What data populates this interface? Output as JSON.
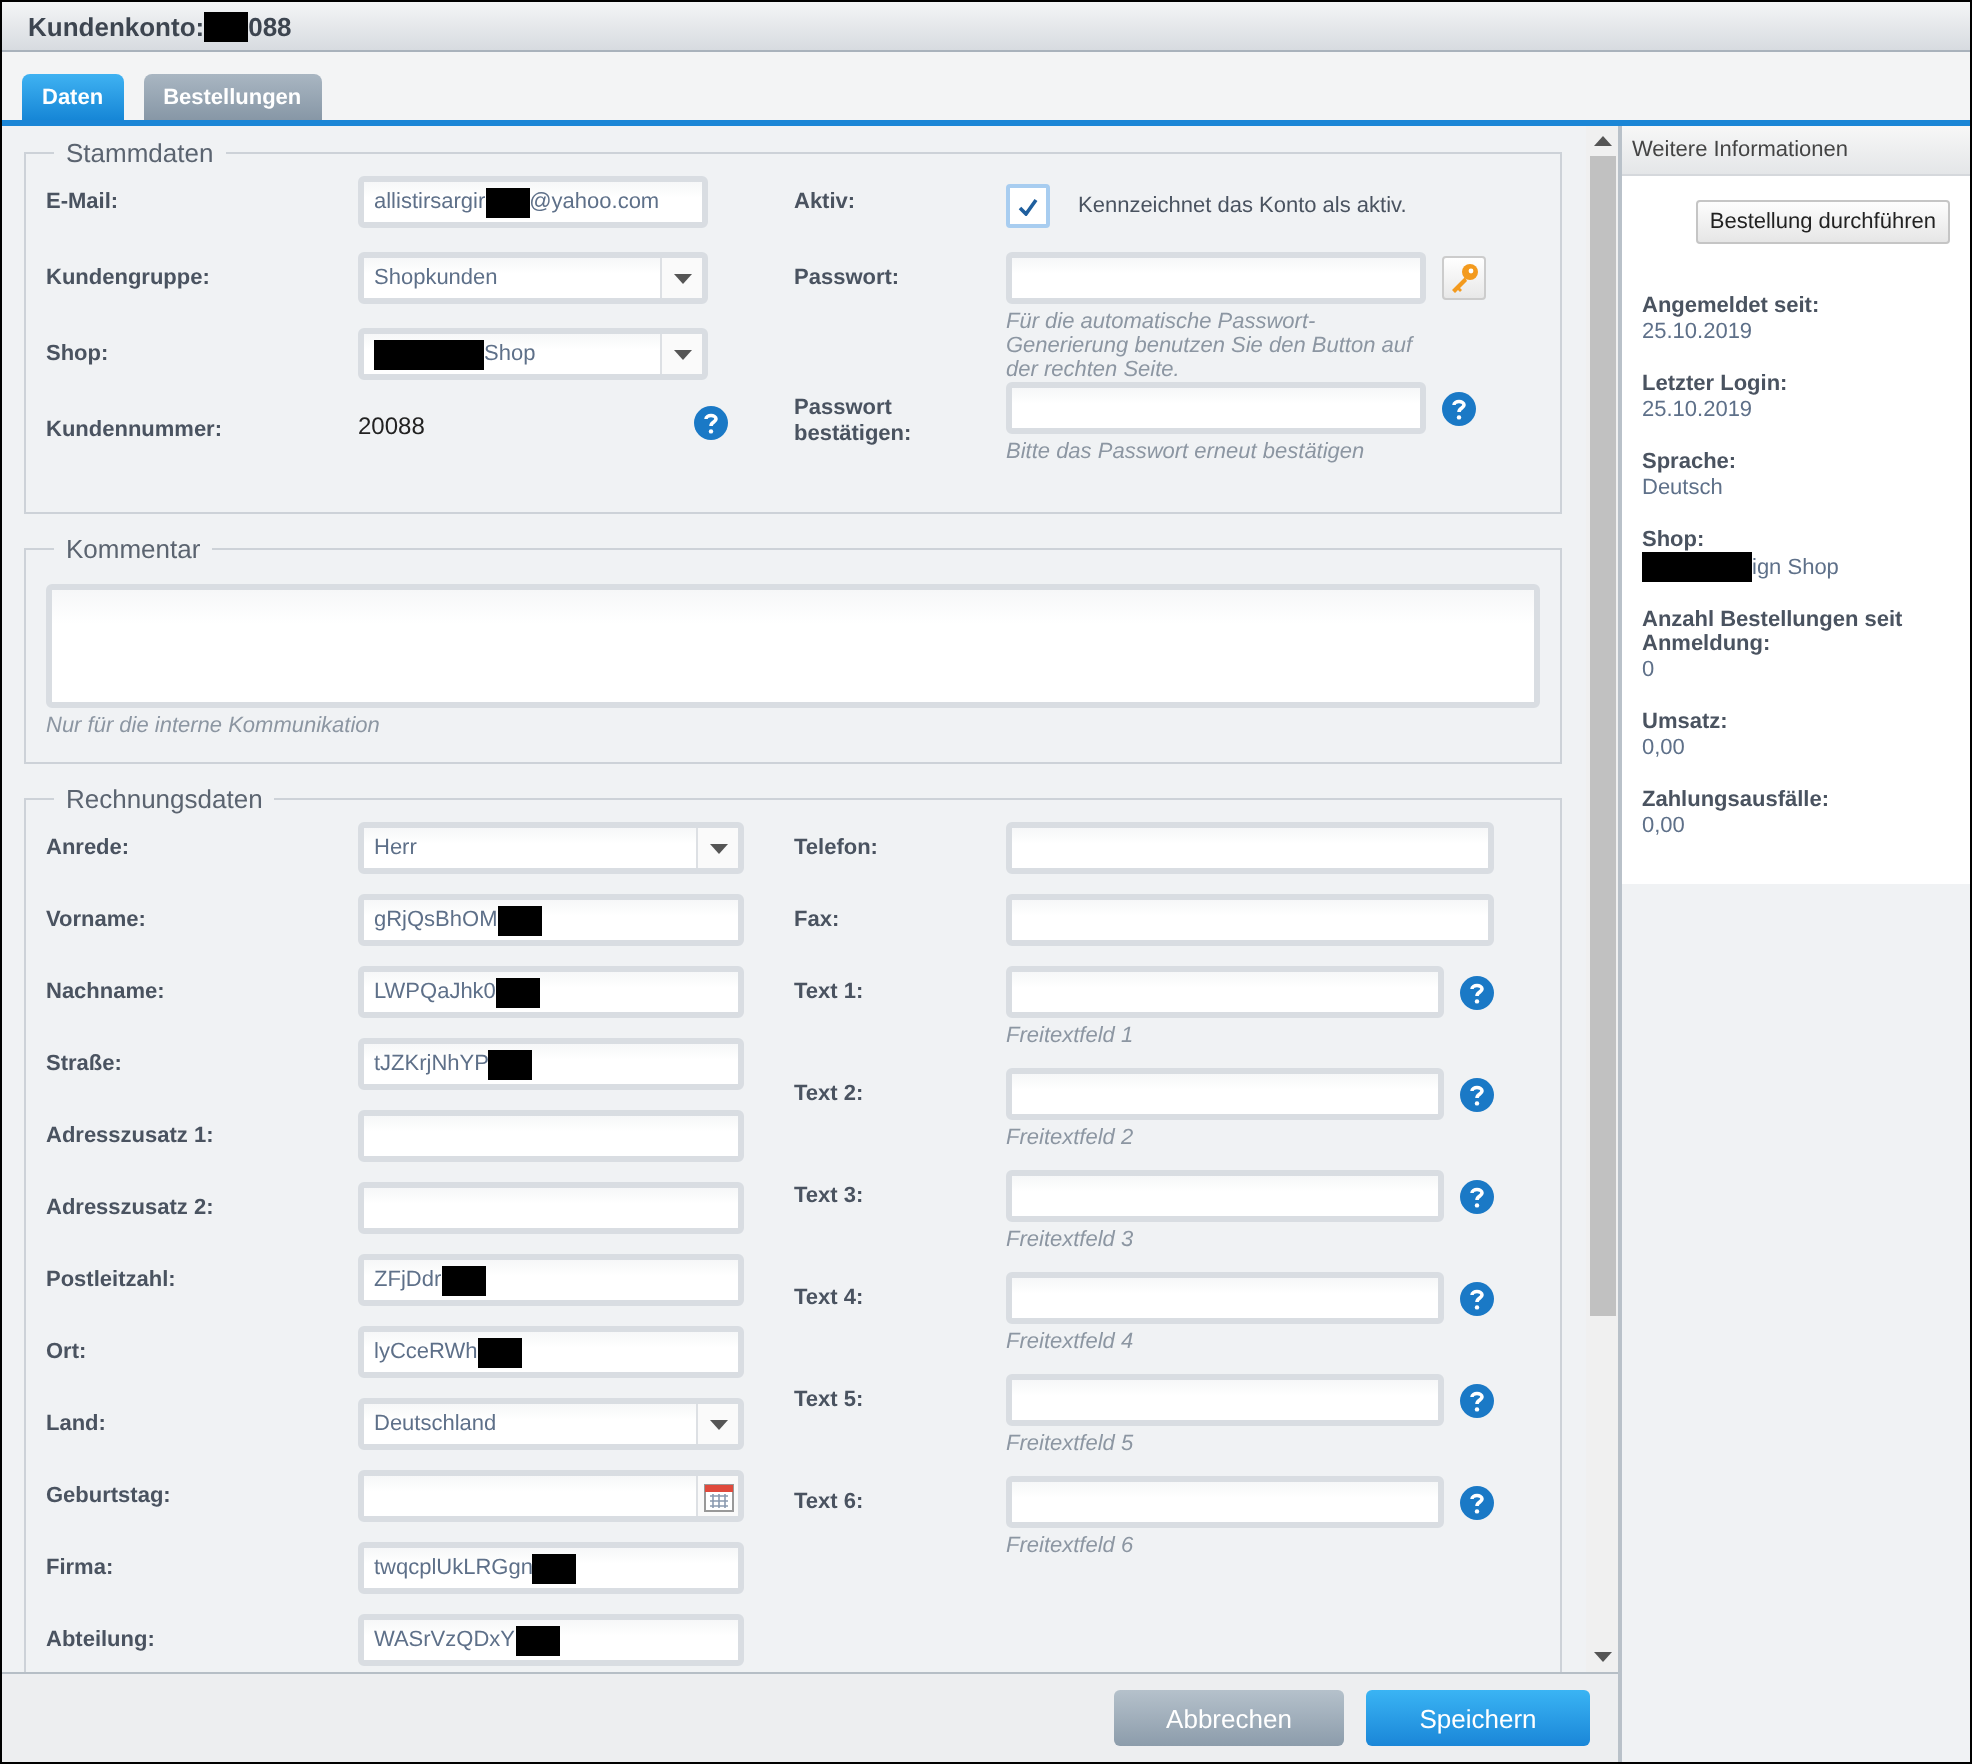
{
  "window": {
    "title_parts": [
      {
        "text": "Kundenkonto:"
      },
      {
        "kind": "redacted"
      },
      {
        "text": "088"
      }
    ]
  },
  "tabs": [
    {
      "label": "Daten",
      "selected": true
    },
    {
      "label": "Bestellungen",
      "selected": false
    }
  ],
  "stammdaten": {
    "legend": "Stammdaten",
    "left": [
      {
        "kind": "input",
        "label": "E-Mail:",
        "parts": [
          {
            "text": "allistirsargir"
          },
          {
            "kind": "redacted"
          },
          {
            "text": "@yahoo.com"
          }
        ]
      },
      {
        "kind": "select",
        "label": "Kundengruppe:",
        "parts": [
          {
            "text": "Shopkunden"
          }
        ]
      },
      {
        "kind": "select",
        "label": "Shop:",
        "parts": [
          {
            "kind": "redacted"
          },
          {
            "text": "Shop"
          }
        ]
      },
      {
        "kind": "static",
        "label": "Kundennummer:",
        "value": "20088",
        "help": true
      }
    ],
    "right": [
      {
        "kind": "checkbox",
        "label": "Aktiv:",
        "checked": true,
        "text": "Kennzeichnet das Konto als aktiv."
      },
      {
        "kind": "input",
        "label": "Passwort:",
        "key_button": true,
        "hint": "Für die automatische Passwort-Generierung benutzen Sie den Button auf der rechten Seite."
      },
      {
        "kind": "input",
        "label": "Passwort bestätigen:",
        "help": true,
        "hint": "Bitte das Passwort erneut bestätigen"
      }
    ]
  },
  "kommentar": {
    "legend": "Kommentar",
    "hint": "Nur für die interne Kommunikation"
  },
  "rechnungsdaten": {
    "legend": "Rechnungsdaten",
    "left": [
      {
        "kind": "select",
        "label": "Anrede:",
        "parts": [
          {
            "text": "Herr"
          }
        ]
      },
      {
        "kind": "input",
        "label": "Vorname:",
        "parts": [
          {
            "text": "gRjQsBhOM"
          },
          {
            "kind": "redacted"
          }
        ]
      },
      {
        "kind": "input",
        "label": "Nachname:",
        "parts": [
          {
            "text": "LWPQaJhk0"
          },
          {
            "kind": "redacted"
          }
        ]
      },
      {
        "kind": "input",
        "label": "Straße:",
        "parts": [
          {
            "text": "tJZKrjNhYP"
          },
          {
            "kind": "redacted"
          }
        ]
      },
      {
        "kind": "input",
        "label": "Adresszusatz 1:"
      },
      {
        "kind": "input",
        "label": "Adresszusatz 2:"
      },
      {
        "kind": "input",
        "label": "Postleitzahl:",
        "parts": [
          {
            "text": "ZFjDdr"
          },
          {
            "kind": "redacted"
          }
        ]
      },
      {
        "kind": "input",
        "label": "Ort:",
        "parts": [
          {
            "text": "lyCceRWh"
          },
          {
            "kind": "redacted"
          }
        ]
      },
      {
        "kind": "select",
        "label": "Land:",
        "parts": [
          {
            "text": "Deutschland"
          }
        ]
      },
      {
        "kind": "date",
        "label": "Geburtstag:"
      },
      {
        "kind": "input",
        "label": "Firma:",
        "parts": [
          {
            "text": "twqcplUkLRGgn"
          },
          {
            "kind": "redacted"
          }
        ]
      },
      {
        "kind": "input",
        "label": "Abteilung:",
        "parts": [
          {
            "text": "WASrVzQDxY"
          },
          {
            "kind": "redacted"
          }
        ]
      }
    ],
    "right": [
      {
        "kind": "input",
        "label": "Telefon:"
      },
      {
        "kind": "input",
        "label": "Fax:"
      },
      {
        "kind": "input",
        "label": "Text 1:",
        "help": true,
        "hint": "Freitextfeld 1"
      },
      {
        "kind": "input",
        "label": "Text 2:",
        "help": true,
        "hint": "Freitextfeld 2"
      },
      {
        "kind": "input",
        "label": "Text 3:",
        "help": true,
        "hint": "Freitextfeld 3"
      },
      {
        "kind": "input",
        "label": "Text 4:",
        "help": true,
        "hint": "Freitextfeld 4"
      },
      {
        "kind": "input",
        "label": "Text 5:",
        "help": true,
        "hint": "Freitextfeld 5"
      },
      {
        "kind": "input",
        "label": "Text 6:",
        "help": true,
        "hint": "Freitextfeld 6"
      }
    ]
  },
  "sidebar": {
    "title": "Weitere Informationen",
    "button": "Bestellung durchführen",
    "items": [
      {
        "label": "Angemeldet seit:",
        "parts": [
          {
            "text": "25.10.2019"
          }
        ]
      },
      {
        "label": "Letzter Login:",
        "parts": [
          {
            "text": "25.10.2019"
          }
        ]
      },
      {
        "label": "Sprache:",
        "parts": [
          {
            "text": "Deutsch"
          }
        ]
      },
      {
        "label": "Shop:",
        "parts": [
          {
            "kind": "redacted"
          },
          {
            "text": "ign Shop"
          }
        ]
      },
      {
        "label": "Anzahl Bestellungen seit Anmeldung:",
        "parts": [
          {
            "text": "0"
          }
        ]
      },
      {
        "label": "Umsatz:",
        "parts": [
          {
            "text": "0,00"
          }
        ]
      },
      {
        "label": "Zahlungsausfälle:",
        "parts": [
          {
            "text": "0,00"
          }
        ]
      }
    ]
  },
  "footer": {
    "buttons": [
      {
        "label": "Abbrechen",
        "kind": "secondary"
      },
      {
        "label": "Speichern",
        "kind": "primary"
      }
    ]
  }
}
